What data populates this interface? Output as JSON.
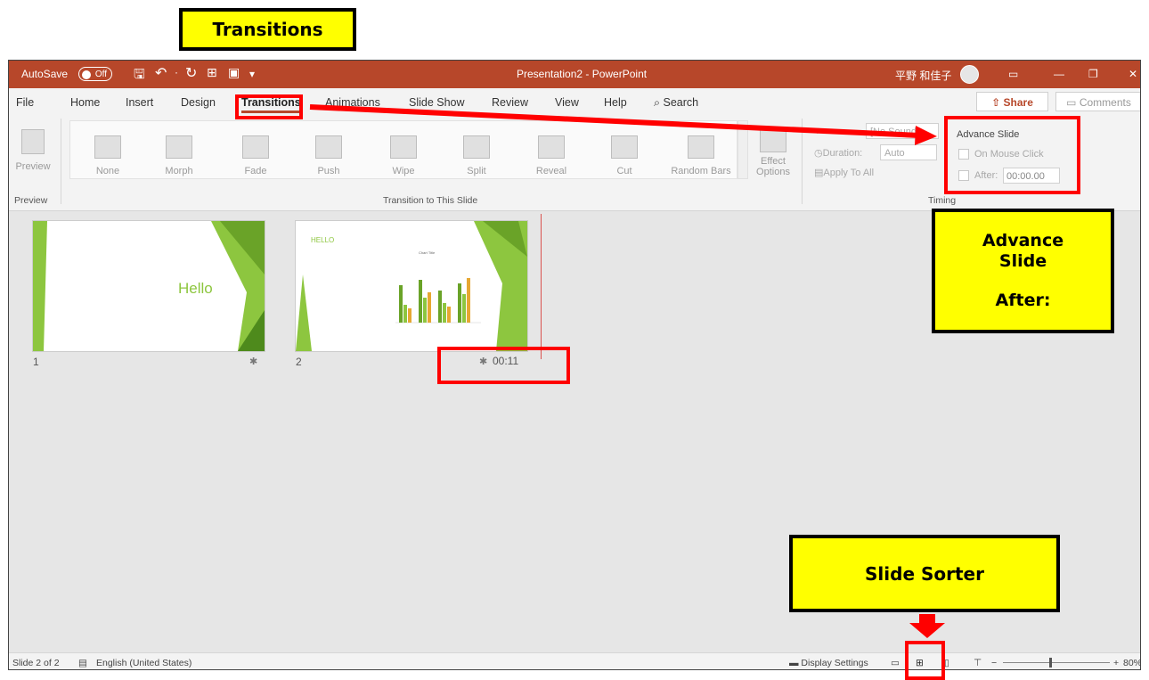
{
  "callouts": {
    "transitions": "Transitions",
    "advance_slide_line1": "Advance",
    "advance_slide_line2": "Slide",
    "advance_slide_line3": "After:",
    "slide_sorter": "Slide Sorter"
  },
  "titlebar": {
    "autosave": "AutoSave",
    "autosave_state": "Off",
    "doc_title": "Presentation2  -  PowerPoint",
    "user_name": "平野 和佳子"
  },
  "tabs": [
    "File",
    "Home",
    "Insert",
    "Design",
    "Transitions",
    "Animations",
    "Slide Show",
    "Review",
    "View",
    "Help"
  ],
  "search_label": "Search",
  "share_label": "Share",
  "comments_label": "Comments",
  "ribbon": {
    "preview_label": "Preview",
    "preview_group": "Preview",
    "gallery": [
      "None",
      "Morph",
      "Fade",
      "Push",
      "Wipe",
      "Split",
      "Reveal",
      "Cut",
      "Random Bars"
    ],
    "effect_options_line1": "Effect",
    "effect_options_line2": "Options",
    "transition_group": "Transition to This Slide",
    "sound_value": "[No Sound]",
    "duration_label": "Duration:",
    "duration_value": "Auto",
    "apply_to_all": "Apply To All",
    "advance_slide": "Advance Slide",
    "on_mouse_click": "On Mouse Click",
    "after_label": "After:",
    "after_value": "00:00.00",
    "timing_group": "Timing"
  },
  "slides": [
    {
      "number": "1",
      "title": "Hello",
      "timing": ""
    },
    {
      "number": "2",
      "title": "HELLO",
      "chart_title": "Chart Title",
      "timing": "00:11"
    }
  ],
  "statusbar": {
    "slide_of": "Slide 2 of 2",
    "language": "English (United States)",
    "display_settings": "Display Settings",
    "zoom": "80%"
  },
  "colors": {
    "accent": "#b7472a",
    "callout": "#ffff00",
    "highlight": "#ff0000",
    "slide_green": "#8dc63f"
  }
}
